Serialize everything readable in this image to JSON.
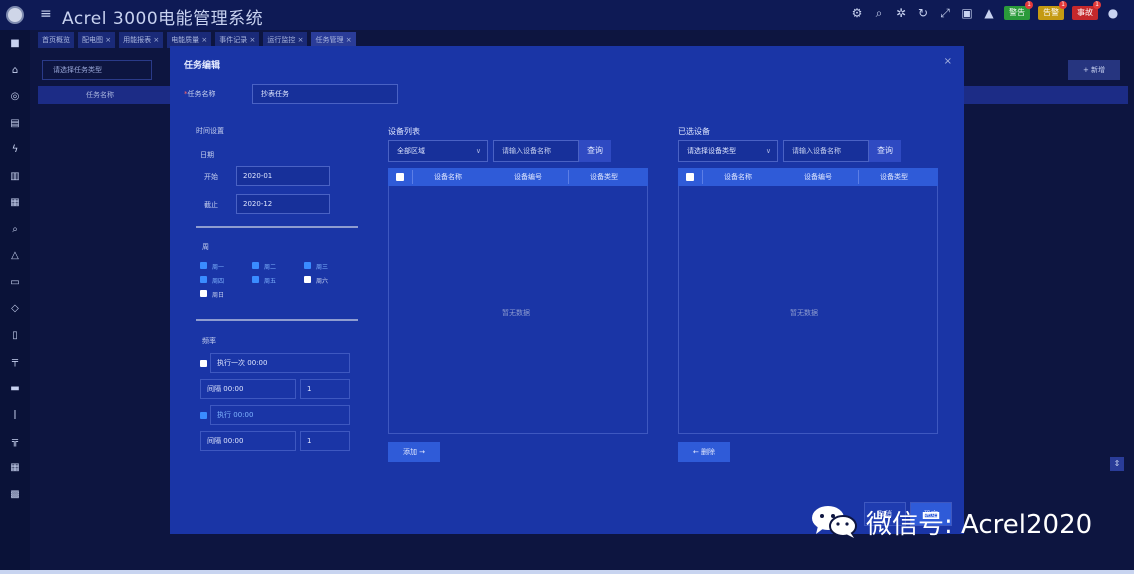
{
  "app": {
    "title": "Acrel 3000电能管理系统",
    "menu_icon": "hamburger-menu-icon"
  },
  "header": {
    "tools": [
      "user-settings-icon",
      "search-icon",
      "theme-icon",
      "refresh-icon",
      "fullscreen-icon",
      "screen-icon",
      "hat-icon"
    ],
    "alarms": [
      {
        "label": "警告",
        "count": "1",
        "color": "#2a9a3a"
      },
      {
        "label": "告警",
        "count": "1",
        "color": "#c49a12"
      },
      {
        "label": "事故",
        "count": "1",
        "color": "#c4282b"
      }
    ],
    "user_icon": "user-icon"
  },
  "tabs": [
    {
      "label": "首页概览",
      "active": false
    },
    {
      "label": "配电图 ×",
      "active": false
    },
    {
      "label": "用能报表 ×",
      "active": false
    },
    {
      "label": "电能质量 ×",
      "active": false
    },
    {
      "label": "事件记录 ×",
      "active": false
    },
    {
      "label": "运行监控 ×",
      "active": false
    },
    {
      "label": "任务管理 ×",
      "active": true
    }
  ],
  "background": {
    "select_text": "请选择任务类型",
    "add_label": "+ 新增",
    "table_header": "任务名称",
    "scroll_icon": "scroll-arrows-icon"
  },
  "modal": {
    "title": "任务编辑",
    "close": "×",
    "name_label": "任务名称",
    "name_required": "*",
    "name_value": "抄表任务",
    "time_section": {
      "title": "时间设置",
      "date_label": "日期",
      "start_label": "开始",
      "start_value": "2020-01",
      "end_label": "截止",
      "end_value": "2020-12"
    },
    "week_section": {
      "title": "周",
      "days": [
        {
          "label": "周一",
          "checked": true
        },
        {
          "label": "周二",
          "checked": true
        },
        {
          "label": "周三",
          "checked": true
        },
        {
          "label": "周四",
          "checked": true
        },
        {
          "label": "周五",
          "checked": true
        },
        {
          "label": "周六",
          "checked": false
        },
        {
          "label": "周日",
          "checked": false
        }
      ]
    },
    "freq_section": {
      "title": "频率",
      "row1_label": "执行一次",
      "row1_value": "00:00",
      "row2_label": "间隔",
      "row2_value": "00:00",
      "row2_num": "1",
      "row3_label": "执行",
      "row3_value": "00:00",
      "row4_label": "间隔",
      "row4_value": "00:00",
      "row4_num": "1"
    },
    "left_panel": {
      "title": "设备列表",
      "select_value": "全部区域",
      "search_placeholder": "请输入设备名称",
      "search_button": "查询",
      "columns": [
        "设备名称",
        "设备编号",
        "设备类型"
      ],
      "empty_text": "暂无数据",
      "move_button": "添加 →"
    },
    "right_panel": {
      "title": "已选设备",
      "select_value": "请选择设备类型",
      "search_placeholder": "请输入设备名称",
      "search_button": "查询",
      "columns": [
        "设备名称",
        "设备编号",
        "设备类型"
      ],
      "empty_text": "暂无数据",
      "move_button": "← 删除"
    },
    "footer": {
      "cancel_label": "取消",
      "confirm_label": "确定"
    }
  },
  "watermark": {
    "text": "微信号: Acrel2020",
    "icon": "wechat-icon"
  }
}
